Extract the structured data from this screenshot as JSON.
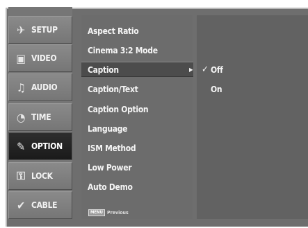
{
  "categories": [
    {
      "label": "SETUP",
      "icon": "satellite-icon",
      "glyph": "✈"
    },
    {
      "label": "VIDEO",
      "icon": "video-icon",
      "glyph": "▣"
    },
    {
      "label": "AUDIO",
      "icon": "audio-icon",
      "glyph": "♫"
    },
    {
      "label": "TIME",
      "icon": "clock-icon",
      "glyph": "◔"
    },
    {
      "label": "OPTION",
      "icon": "option-icon",
      "glyph": "✎"
    },
    {
      "label": "LOCK",
      "icon": "lock-icon",
      "glyph": "🔒"
    },
    {
      "label": "CABLE",
      "icon": "cable-icon",
      "glyph": "✔"
    }
  ],
  "active_category": "OPTION",
  "submenu": {
    "items": [
      "Aspect Ratio",
      "Cinema 3:2 Mode",
      "Caption",
      "Caption/Text",
      "Caption Option",
      "Language",
      "ISM Method",
      "Low Power",
      "Auto Demo"
    ],
    "active_item": "Caption"
  },
  "options": {
    "items": [
      "Off",
      "On"
    ],
    "selected": "Off"
  },
  "footer": {
    "key_label": "MENU",
    "text": "Previous"
  },
  "colors": {
    "screen_bg": "#6e6e6e",
    "active_category_bg": "#1f1f1f",
    "highlight_bg": "#4c4c4c",
    "text": "#f4f4f4"
  }
}
